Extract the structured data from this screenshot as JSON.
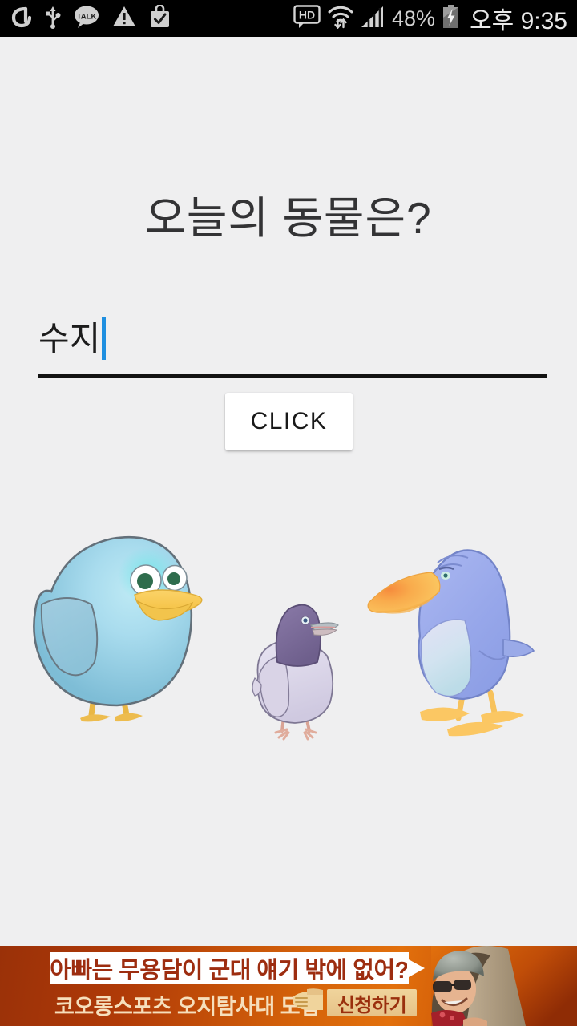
{
  "status_bar": {
    "left_icons": [
      {
        "name": "sigma-icon",
        "glyph": "σ"
      },
      {
        "name": "usb-icon",
        "glyph": "usb"
      },
      {
        "name": "kakaotalk-icon",
        "glyph": "TALK"
      },
      {
        "name": "warning-icon",
        "glyph": "!"
      },
      {
        "name": "bag-check-icon",
        "glyph": "bag"
      }
    ],
    "hd_label": "HD",
    "wifi_icon": "wifi-updown-icon",
    "signal_icon": "signal-bars-icon",
    "battery_percent": "48%",
    "battery_icon": "battery-charging-icon",
    "clock": "오후 9:35"
  },
  "app": {
    "title": "오늘의 동물은?",
    "input": {
      "value": "수지",
      "placeholder": "",
      "caret_color": "#1f8fe0",
      "underline_color": "#121212"
    },
    "click_button_label": "CLICK",
    "birds": [
      {
        "name": "blue-chick-image",
        "label": "파란 병아리"
      },
      {
        "name": "pigeon-image",
        "label": "비둘기"
      },
      {
        "name": "blue-duck-image",
        "label": "파란 오리"
      }
    ]
  },
  "ad": {
    "headline": "아빠는 무용담이 군대 얘기 밖에 없어?",
    "subline": "코오롱스포츠 오지탐사대 모집",
    "cta_label": "신청하기",
    "bg_color": "#c4500a",
    "headline_color": "#9d2d10",
    "subline_color": "#f6dfbc",
    "photo_alt": "헬멧 쓴 사람 사진"
  }
}
